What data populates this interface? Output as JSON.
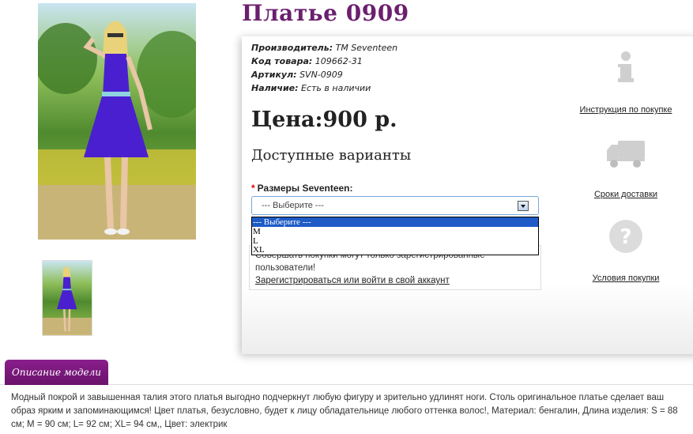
{
  "product": {
    "title": "Платье 0909",
    "meta": [
      {
        "label": "Производитель:",
        "value": "TM Seventeen"
      },
      {
        "label": "Код товара:",
        "value": "109662-31"
      },
      {
        "label": "Артикул:",
        "value": "SVN-0909"
      },
      {
        "label": "Наличие:",
        "value": "Есть в наличии"
      }
    ],
    "price": "Цена:900 р.",
    "variants_heading": "Доступные варианты"
  },
  "size_option": {
    "required_mark": "*",
    "label": "Размеры Seventeen:",
    "selected": "--- Выберите ---",
    "options": [
      "--- Выберите ---",
      "M",
      "L",
      "XL"
    ]
  },
  "login_notice": {
    "line1": "Совершать покупки могут только зарегистрированные",
    "line2": "пользователи!",
    "link": "Зарегистрироваться или войти в свой аккаунт"
  },
  "sidebar": [
    {
      "icon": "info-icon",
      "label": "Инструкция по покупке"
    },
    {
      "icon": "truck-icon",
      "label": "Сроки доставки"
    },
    {
      "icon": "question-icon",
      "label": "Условия покупки"
    }
  ],
  "description": {
    "tab": "Описание модели",
    "text": "Модный покрой и завышенная талия этого платья выгодно подчеркнут любую фигуру и зрительно удлинят ноги. Столь оригинальное платье сделает ваш образ ярким и запоминающимся! Цвет платья, безусловно, будет к лицу обладательнице любого оттенка волос!, Материал: бенгалин, Длина изделия: S = 88 см; M = 90 см; L= 92 см; XL= 94 см,, Цвет: электрик"
  },
  "colors": {
    "accent": "#6b1f6e",
    "tab": "#7a1a7c",
    "dress": "#4a1fd0",
    "selection": "#1e5bc6"
  }
}
